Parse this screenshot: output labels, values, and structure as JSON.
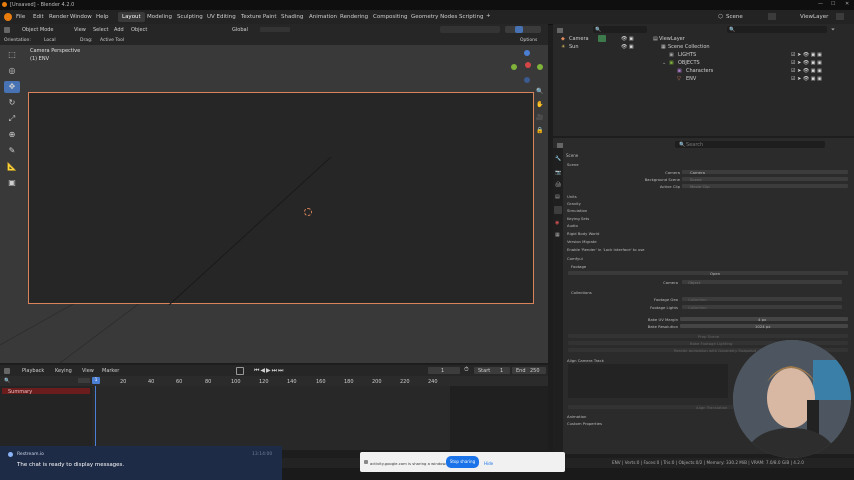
{
  "app": {
    "title": "[Unsaved] - Blender 4.2.0"
  },
  "menu": [
    "File",
    "Edit",
    "Render",
    "Window",
    "Help"
  ],
  "workspaces": [
    "Layout",
    "Modeling",
    "Sculpting",
    "UV Editing",
    "Texture Paint",
    "Shading",
    "Animation",
    "Rendering",
    "Compositing",
    "Geometry Nodes",
    "Scripting"
  ],
  "workspace_add": "+",
  "scene": {
    "label": "Scene",
    "view_layer": "ViewLayer"
  },
  "viewport_header": {
    "mode": "Object Mode",
    "view": "View",
    "select": "Select",
    "add": "Add",
    "object": "Object",
    "transform": "Global",
    "options": "Options"
  },
  "viewport_header2": {
    "orientation_label": "Orientation:",
    "orientation": "Local",
    "drag_label": "Drag:",
    "drag": "Active Tool"
  },
  "viewport": {
    "camera_title": "Camera Perspective",
    "object_label": "(1) ENV"
  },
  "outliner": {
    "top_items": [
      "Camera",
      "Sun"
    ],
    "tree": [
      "Scene Collection",
      "LIGHTS",
      "OBJECTS",
      "Characters",
      "ENV"
    ]
  },
  "properties": {
    "search": "Search",
    "scene_label": "Scene",
    "section_scene": "Scene",
    "rows": [
      {
        "label": "Camera",
        "value": "Camera"
      },
      {
        "label": "Background Scene",
        "value": "Scene"
      },
      {
        "label": "Active Clip",
        "value": "Movie Clip"
      }
    ],
    "panels": [
      "Units",
      "Gravity",
      "Simulation",
      "Keying Sets",
      "Audio",
      "Rigid Body World",
      "Version Migrate"
    ],
    "note": "Enable 'Render' in 'Lock Interface' to use",
    "comfyui": "Comfyui",
    "footage": "Footage",
    "open": "Open",
    "camera_label": "Camera",
    "camera_value": "Object",
    "collections": "Collections",
    "footage_geo": "Footage Geo",
    "footage_lights": "Footage Lights",
    "collection_placeholder": "Collection",
    "bake_uv_margin_label": "Bake UV Margin",
    "bake_uv_margin": "4 px",
    "bake_resolution_label": "Bake Resolution",
    "bake_resolution": "1024 px",
    "buttons": [
      "Prep Scene",
      "Bake Footage Lighting",
      "Render animation with Geometry Snapshot"
    ],
    "align_camera_track": "Align Camera Track",
    "align_button": "Align Translation",
    "animation": "Animation",
    "custom_properties": "Custom Properties"
  },
  "timeline": {
    "playback": "Playback",
    "keying": "Keying",
    "view": "View",
    "marker": "Marker",
    "current_frame": "1",
    "start_label": "Start",
    "start": "1",
    "end_label": "End",
    "end": "250",
    "summary": "Summary",
    "frame_indicator": "1",
    "ticks": [
      "20",
      "40",
      "60",
      "80",
      "100",
      "120",
      "140",
      "160",
      "180",
      "200",
      "220",
      "240"
    ]
  },
  "status": {
    "text": "ENV | Verts:0 | Faces:0 | Tris:0 | Objects:0/2 | Memory: 330.2 MiB | VRAM: 7.0/8.0 GiB | 4.2.0"
  },
  "chat": {
    "source": "Restream.io",
    "time": "13:14:00",
    "message": "The chat is ready to display messages."
  },
  "share": {
    "text": "activity.google.com is sharing a window.",
    "stop": "Stop sharing",
    "hide": "Hide"
  },
  "colors": {
    "accent": "#4772b3",
    "camera_frame": "#d8835a",
    "timeline_playhead": "#4a7fd4",
    "summary_bar": "#6b1c1c"
  }
}
